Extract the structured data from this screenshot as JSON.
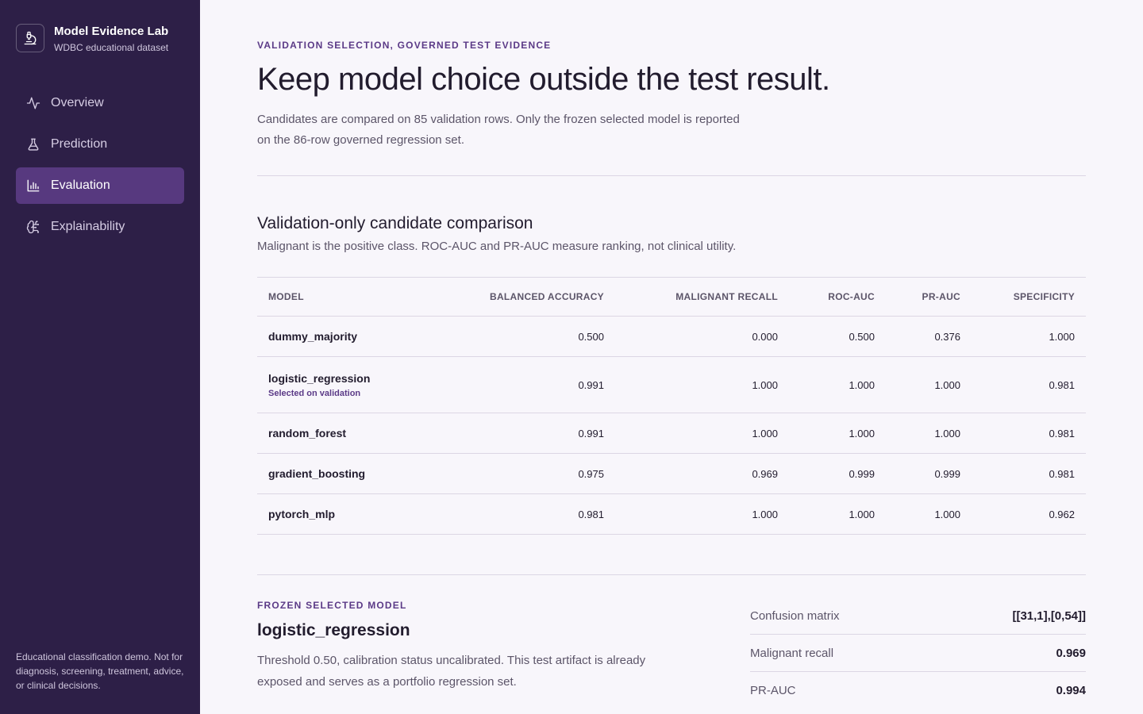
{
  "brand": {
    "title": "Model Evidence Lab",
    "subtitle": "WDBC educational dataset",
    "icon": "microscope-icon"
  },
  "nav": [
    {
      "label": "Overview",
      "icon": "activity-icon",
      "active": false
    },
    {
      "label": "Prediction",
      "icon": "flask-icon",
      "active": false
    },
    {
      "label": "Evaluation",
      "icon": "bar-chart-icon",
      "active": true
    },
    {
      "label": "Explainability",
      "icon": "brain-icon",
      "active": false
    }
  ],
  "disclaimer": "Educational classification demo. Not for diagnosis, screening, treatment, advice, or clinical decisions.",
  "header": {
    "eyebrow": "VALIDATION SELECTION, GOVERNED TEST EVIDENCE",
    "title": "Keep model choice outside the test result.",
    "lead": "Candidates are compared on 85 validation rows. Only the frozen selected model is reported on the 86-row governed regression set."
  },
  "comparison": {
    "title": "Validation-only candidate comparison",
    "subtitle": "Malignant is the positive class. ROC-AUC and PR-AUC measure ranking, not clinical utility.",
    "columns": [
      "MODEL",
      "BALANCED ACCURACY",
      "MALIGNANT RECALL",
      "ROC-AUC",
      "PR-AUC",
      "SPECIFICITY"
    ],
    "rows": [
      {
        "model": "dummy_majority",
        "badge": "",
        "values": [
          "0.500",
          "0.000",
          "0.500",
          "0.376",
          "1.000"
        ]
      },
      {
        "model": "logistic_regression",
        "badge": "Selected on validation",
        "values": [
          "0.991",
          "1.000",
          "1.000",
          "1.000",
          "0.981"
        ]
      },
      {
        "model": "random_forest",
        "badge": "",
        "values": [
          "0.991",
          "1.000",
          "1.000",
          "1.000",
          "0.981"
        ]
      },
      {
        "model": "gradient_boosting",
        "badge": "",
        "values": [
          "0.975",
          "0.969",
          "0.999",
          "0.999",
          "0.981"
        ]
      },
      {
        "model": "pytorch_mlp",
        "badge": "",
        "values": [
          "0.981",
          "1.000",
          "1.000",
          "1.000",
          "0.962"
        ]
      }
    ]
  },
  "frozen": {
    "eyebrow": "FROZEN SELECTED MODEL",
    "title": "logistic_regression",
    "description": "Threshold 0.50, calibration status uncalibrated. This test artifact is already exposed and serves as a portfolio regression set.",
    "metrics": [
      {
        "label": "Confusion matrix",
        "value": "[[31,1],[0,54]]"
      },
      {
        "label": "Malignant recall",
        "value": "0.969"
      },
      {
        "label": "PR-AUC",
        "value": "0.994"
      }
    ]
  },
  "colors": {
    "sidebar": "#2d1f47",
    "active_nav": "#57397f",
    "accent": "#5b3a87",
    "background": "#f8f6fb"
  }
}
